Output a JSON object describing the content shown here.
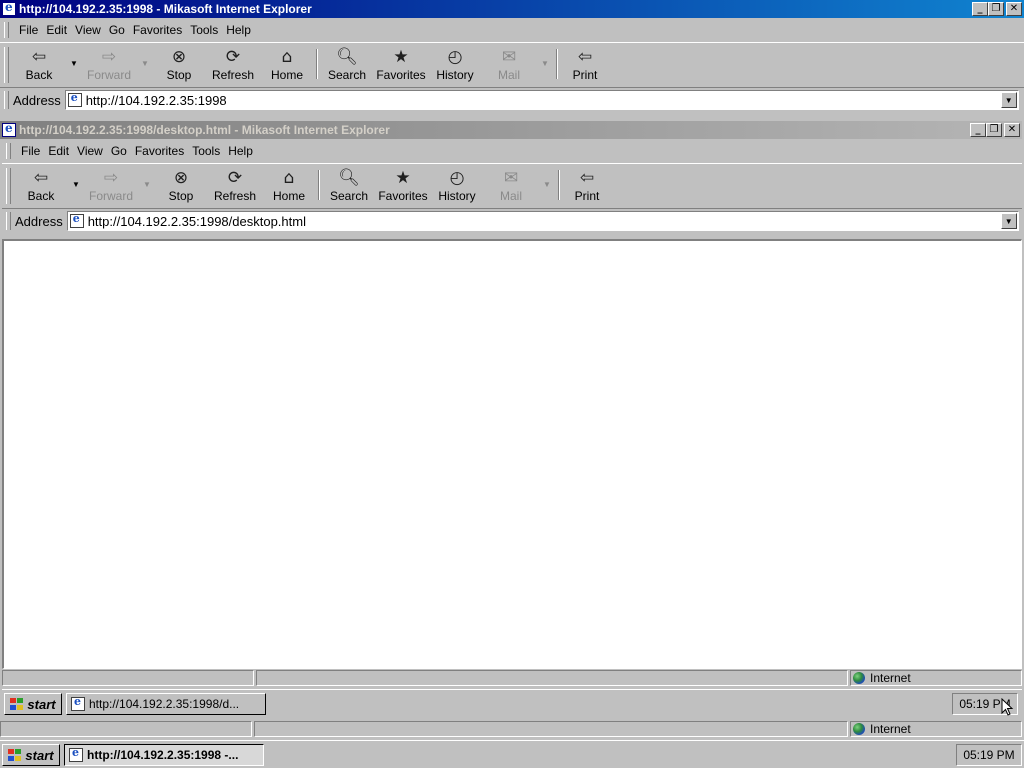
{
  "outer_window": {
    "title": "http://104.192.2.35:1998 - Mikasoft Internet Explorer",
    "menu": [
      "File",
      "Edit",
      "View",
      "Go",
      "Favorites",
      "Tools",
      "Help"
    ],
    "toolbar": {
      "back": "Back",
      "forward": "Forward",
      "stop": "Stop",
      "refresh": "Refresh",
      "home": "Home",
      "search": "Search",
      "favorites": "Favorites",
      "history": "History",
      "mail": "Mail",
      "print": "Print"
    },
    "address_label": "Address",
    "address_url": "http://104.192.2.35:1998",
    "status_zone": "Internet"
  },
  "inner_window": {
    "title": "http://104.192.2.35:1998/desktop.html - Mikasoft Internet Explorer",
    "menu": [
      "File",
      "Edit",
      "View",
      "Go",
      "Favorites",
      "Tools",
      "Help"
    ],
    "toolbar": {
      "back": "Back",
      "forward": "Forward",
      "stop": "Stop",
      "refresh": "Refresh",
      "home": "Home",
      "search": "Search",
      "favorites": "Favorites",
      "history": "History",
      "mail": "Mail",
      "print": "Print"
    },
    "address_label": "Address",
    "address_url": "http://104.192.2.35:1998/desktop.html",
    "status_zone": "Internet"
  },
  "inner_taskbar": {
    "start_label": "start",
    "task_item": "http://104.192.2.35:1998/d...",
    "clock": "05:19 PM"
  },
  "outer_taskbar": {
    "start_label": "start",
    "task_item": "http://104.192.2.35:1998 -...",
    "clock": "05:19 PM"
  },
  "icons": {
    "back": "back-arrow-icon",
    "forward": "forward-arrow-icon",
    "stop": "stop-icon",
    "refresh": "refresh-icon",
    "home": "home-icon",
    "search": "search-icon",
    "favorites": "favorites-icon",
    "history": "history-icon",
    "mail": "mail-icon",
    "print": "print-icon"
  },
  "colors": {
    "active_title": "#000080",
    "inactive_title": "#808080",
    "face": "#c0c0c0"
  }
}
